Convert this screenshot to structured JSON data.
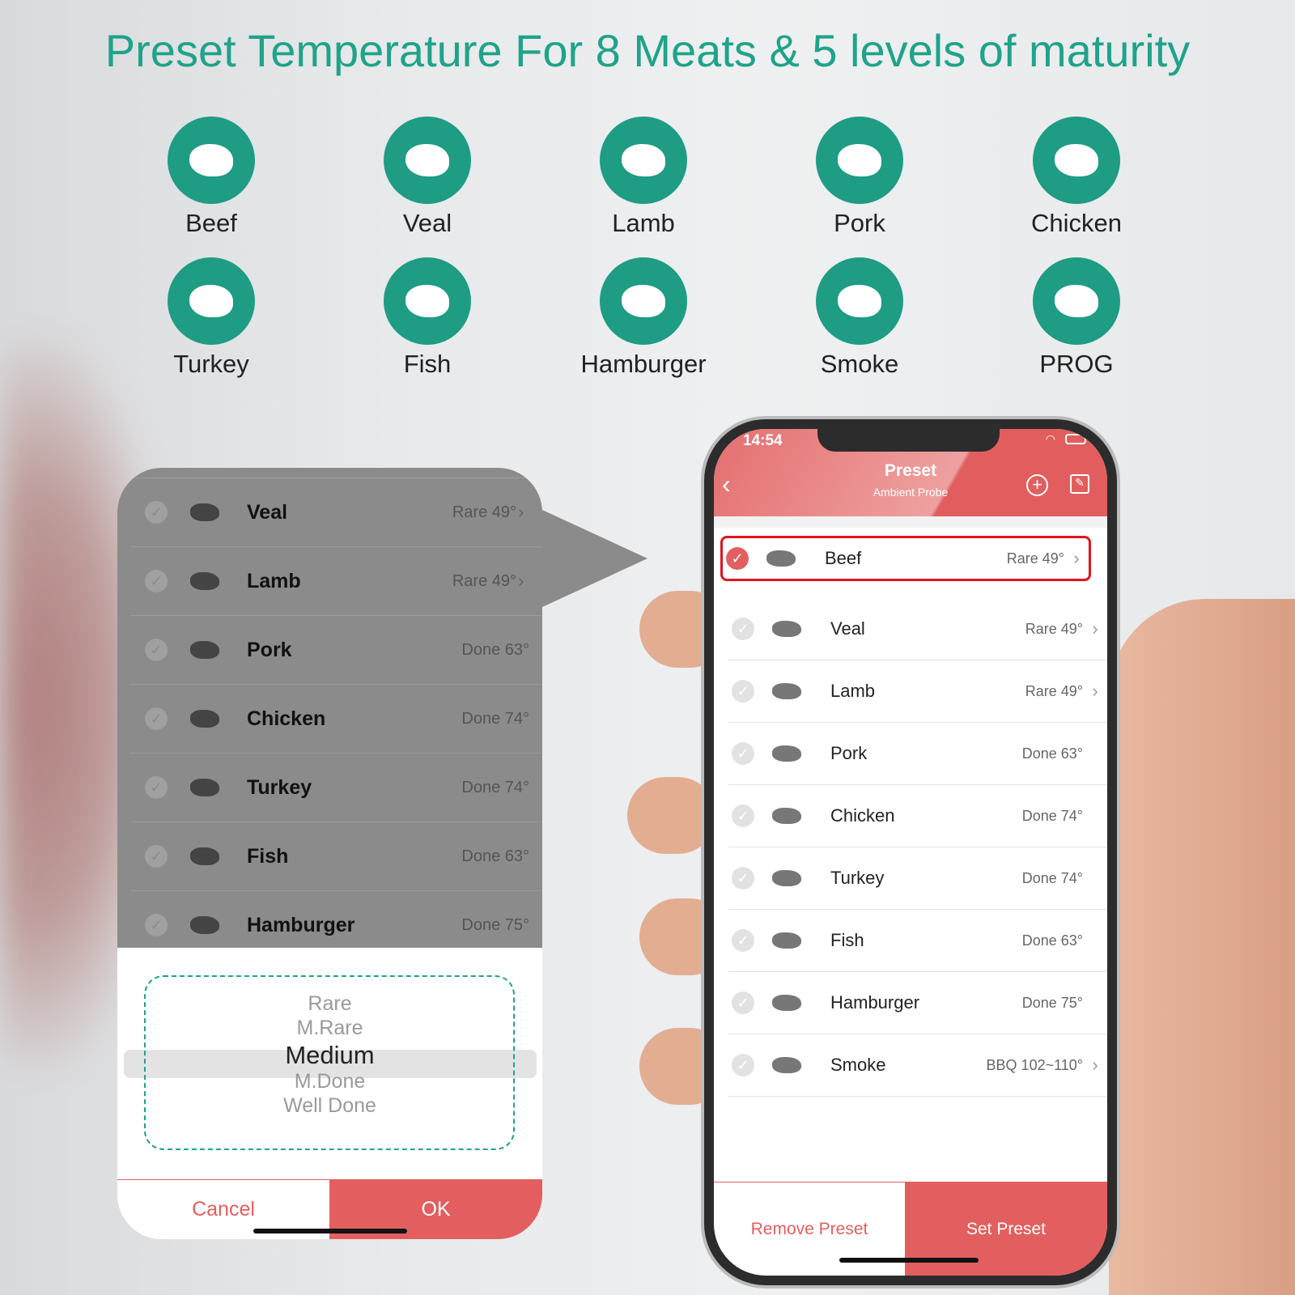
{
  "headline": "Preset Temperature For 8 Meats & 5 levels of maturity",
  "meat_icons": [
    {
      "label": "Beef",
      "icon": "bull-head-icon"
    },
    {
      "label": "Veal",
      "icon": "calf-head-icon"
    },
    {
      "label": "Lamb",
      "icon": "ram-head-icon"
    },
    {
      "label": "Pork",
      "icon": "pig-icon"
    },
    {
      "label": "Chicken",
      "icon": "rooster-icon"
    },
    {
      "label": "Turkey",
      "icon": "roast-turkey-icon"
    },
    {
      "label": "Fish",
      "icon": "fish-icon"
    },
    {
      "label": "Hamburger",
      "icon": "hamburger-icon"
    },
    {
      "label": "Smoke",
      "icon": "grill-icon"
    },
    {
      "label": "PROG",
      "icon": "gear-icon"
    }
  ],
  "popup": {
    "rows": [
      {
        "name": "Veal",
        "value": "Rare 49°",
        "chevron": true
      },
      {
        "name": "Lamb",
        "value": "Rare 49°",
        "chevron": true
      },
      {
        "name": "Pork",
        "value": "Done 63°"
      },
      {
        "name": "Chicken",
        "value": "Done 74°"
      },
      {
        "name": "Turkey",
        "value": "Done 74°"
      },
      {
        "name": "Fish",
        "value": "Done 63°"
      },
      {
        "name": "Hamburger",
        "value": "Done 75°"
      }
    ],
    "options": [
      "Rare",
      "M.Rare",
      "Medium",
      "M.Done",
      "Well Done"
    ],
    "selected": "Medium",
    "cancel": "Cancel",
    "ok": "OK"
  },
  "phone": {
    "time": "14:54",
    "title": "Preset",
    "subtitle": "Ambient Probe",
    "rows": [
      {
        "name": "Beef",
        "value": "Rare 49°",
        "chevron": true,
        "selected": true
      },
      {
        "name": "Veal",
        "value": "Rare 49°",
        "chevron": true
      },
      {
        "name": "Lamb",
        "value": "Rare 49°",
        "chevron": true
      },
      {
        "name": "Pork",
        "value": "Done 63°"
      },
      {
        "name": "Chicken",
        "value": "Done 74°"
      },
      {
        "name": "Turkey",
        "value": "Done 74°"
      },
      {
        "name": "Fish",
        "value": "Done 63°"
      },
      {
        "name": "Hamburger",
        "value": "Done 75°"
      },
      {
        "name": "Smoke",
        "value": "BBQ 102~110°",
        "chevron": true
      }
    ],
    "remove": "Remove Preset",
    "set": "Set Preset"
  },
  "colors": {
    "teal": "#1fa38a",
    "red": "#e35f5f"
  }
}
